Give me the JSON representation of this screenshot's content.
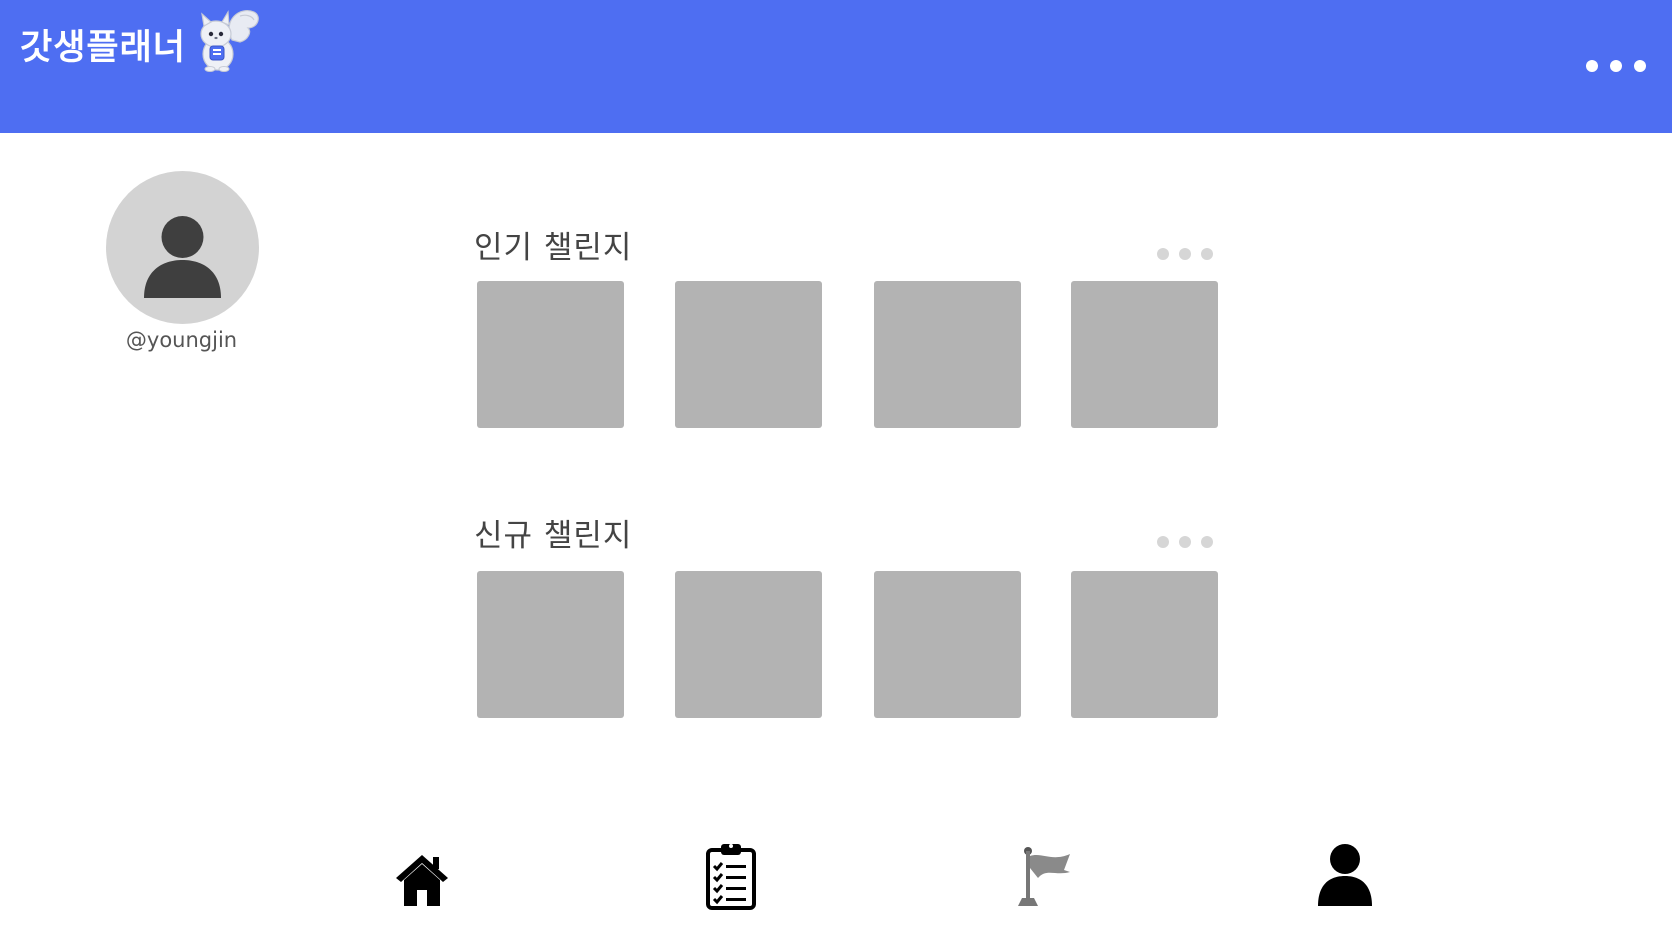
{
  "header": {
    "title": "갓생플래너",
    "mascot_icon": "squirrel-mascot-icon",
    "more_icon": "more-horizontal-icon",
    "background": "#4e6ef2"
  },
  "profile": {
    "avatar_icon": "user-avatar-icon",
    "username": "@youngjin"
  },
  "sections": [
    {
      "title": "인기 챌린지",
      "more_icon": "more-horizontal-icon",
      "card_count": 4
    },
    {
      "title": "신규 챌린지",
      "more_icon": "more-horizontal-icon",
      "card_count": 4
    }
  ],
  "bottom_nav": [
    {
      "id": "home",
      "icon": "home-icon"
    },
    {
      "id": "checklist",
      "icon": "clipboard-checklist-icon"
    },
    {
      "id": "challenge",
      "icon": "flag-icon"
    },
    {
      "id": "profile",
      "icon": "user-icon"
    }
  ],
  "colors": {
    "accent": "#4e6ef2",
    "card": "#b3b3b3",
    "avatar_bg": "#d3d3d3",
    "avatar_fg": "#3f3f3f",
    "dots": "#d6d6d6"
  }
}
